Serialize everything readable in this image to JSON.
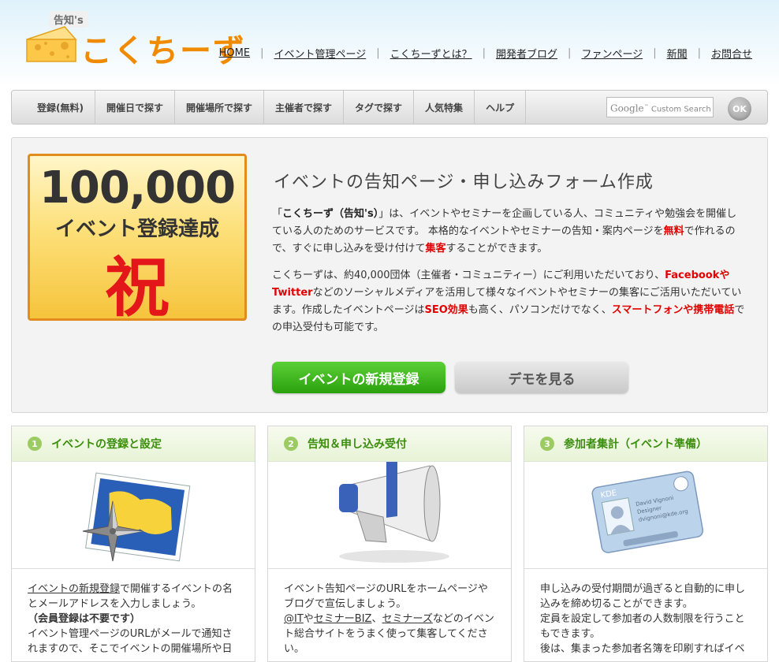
{
  "logo": {
    "small": "告知's",
    "title": "こくちーず"
  },
  "top_nav": [
    "HOME",
    "イベント管理ページ",
    "こくちーずとは？",
    "開発者ブログ",
    "ファンページ",
    "新聞",
    "お問合せ"
  ],
  "menu": [
    "登録(無料)",
    "開催日で探す",
    "開催場所で探す",
    "主催者で探す",
    "タグで探す",
    "人気特集",
    "ヘルプ"
  ],
  "search": {
    "brand": "Google",
    "tm": "™",
    "placeholder": "Custom Search",
    "button": "OK"
  },
  "hero": {
    "badge_number": "100,000",
    "badge_sub": "イベント登録達成",
    "badge_kanji": "祝",
    "title": "イベントの告知ページ・申し込みフォーム作成",
    "p1_a": "「",
    "p1_b": "こくちーず（告知's）",
    "p1_c": "」は、イベントやセミナーを企画している人、コミュニティや勉強会を開催している人のためのサービスです。 本格的なイベントやセミナーの告知・案内ページを",
    "p1_d": "無料",
    "p1_e": "で作れるので、すぐに申し込みを受け付けて",
    "p1_f": "集客",
    "p1_g": "することができます。",
    "p2_a": "こくちーずは、約40,000団体（主催者・コミュニティー）にご利用いただいており、",
    "p2_b": "FacebookやTwitter",
    "p2_c": "などのソーシャルメディアを活用して様々なイベントやセミナーの集客にご活用いただいています。作成したイベントページは",
    "p2_d": "SEO効果",
    "p2_e": "も高く、パソコンだけでなく、",
    "p2_f": "スマートフォンや携帯電話",
    "p2_g": "での申込受付も可能です。",
    "btn_primary": "イベントの新規登録",
    "btn_secondary": "デモを見る"
  },
  "steps": [
    {
      "num": "1",
      "title": "イベントの登録と設定",
      "icon": "map-compass-icon",
      "link": "イベントの新規登録",
      "t1": "で開催するイベントの名とメールアドレスを入力しましょう。",
      "t2": "（会員登録は不要です）",
      "t3": "イベント管理ページのURLがメールで通知されますので、そこでイベントの開催場所や日"
    },
    {
      "num": "2",
      "title": "告知＆申し込み受付",
      "icon": "megaphone-icon",
      "t1": "イベント告知ページのURLをホームページやブログで宣伝しましょう。",
      "link1": "@IT",
      "mid1": "や",
      "link2": "セミナーBIZ",
      "mid2": "、",
      "link3": "セミナーズ",
      "t2": "などのイベント総合サイトをうまく使って集客してください。"
    },
    {
      "num": "3",
      "title": "参加者集計（イベント準備）",
      "icon": "id-card-icon",
      "t1": "申し込みの受付期間が過ぎると自動的に申し込みを締め切ることができます。",
      "t2": "定員を設定して参加者の人数制限を行うこともできます。",
      "t3": "後は、集まった参加者名簿を印刷すればイベ"
    }
  ],
  "card_text": {
    "brand": "KDE",
    "name": "David Vignoni",
    "role": "Designer",
    "email": "dvignoni@kde.org"
  },
  "colors": {
    "accent_orange": "#f08a00",
    "green": "#3a8e0c",
    "red": "#e30000"
  }
}
